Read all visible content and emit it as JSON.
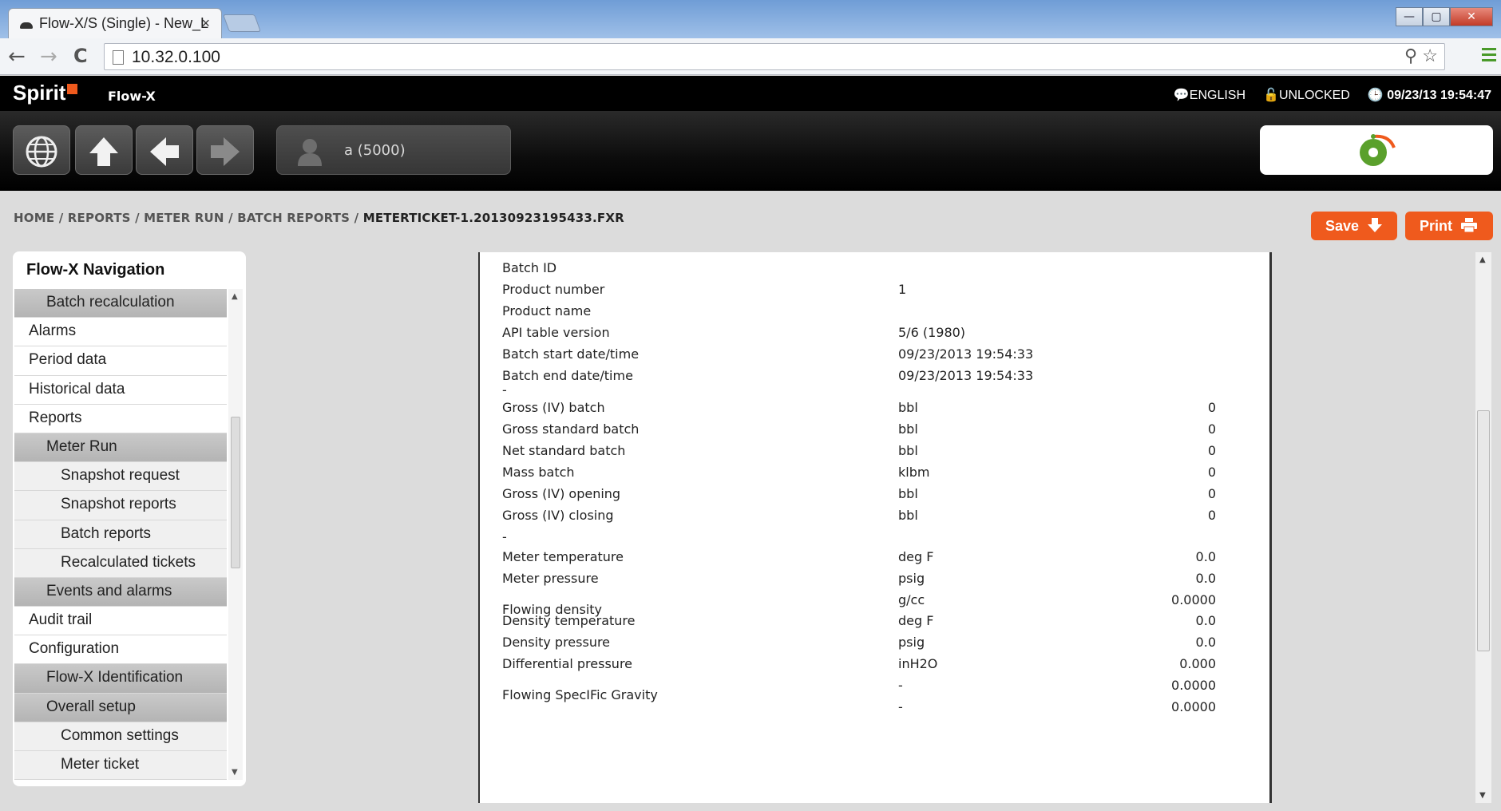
{
  "browser": {
    "tab_title": "Flow-X/S (Single) - New_L",
    "tab_close": "×",
    "url": "10.32.0.100",
    "back": "←",
    "forward": "→",
    "reload": "C",
    "window_controls": [
      "—",
      "▢",
      "✕"
    ],
    "url_tools": "⚲ ☆"
  },
  "app": {
    "logo": "Spirit",
    "product": "Flow-X",
    "language": "ENGLISH",
    "lock_state": "UNLOCKED",
    "datetime": "09/23/13 19:54:47",
    "user": "a (5000)",
    "accent_color": "#ef5a1d"
  },
  "breadcrumb": {
    "path": "HOME / REPORTS / METER RUN / BATCH REPORTS / ",
    "current": "METERTICKET-1.20130923195433.FXR"
  },
  "actions": {
    "save": "Save",
    "print": "Print"
  },
  "nav": {
    "title": "Flow-X Navigation",
    "items": [
      {
        "label": "Batch recalculation",
        "level": 1
      },
      {
        "label": "Alarms",
        "level": 0
      },
      {
        "label": "Period data",
        "level": 0
      },
      {
        "label": "Historical data",
        "level": 0
      },
      {
        "label": "Reports",
        "level": 0
      },
      {
        "label": "Meter Run",
        "level": 1
      },
      {
        "label": "Snapshot request",
        "level": 2
      },
      {
        "label": "Snapshot reports",
        "level": 2
      },
      {
        "label": "Batch reports",
        "level": 2
      },
      {
        "label": "Recalculated tickets",
        "level": 2
      },
      {
        "label": "Events and alarms",
        "level": 1
      },
      {
        "label": "Audit trail",
        "level": 0
      },
      {
        "label": "Configuration",
        "level": 0
      },
      {
        "label": "Flow-X Identification",
        "level": 1
      },
      {
        "label": "Overall setup",
        "level": 1
      },
      {
        "label": "Common settings",
        "level": 2
      },
      {
        "label": "Meter ticket",
        "level": 2
      }
    ]
  },
  "report": {
    "rows": [
      {
        "label": "Batch ID",
        "unit": "",
        "value": ""
      },
      {
        "label": "Product number",
        "unit": "1",
        "value": ""
      },
      {
        "label": "Product name",
        "unit": "",
        "value": ""
      },
      {
        "label": "API table version",
        "unit": "5/6 (1980)",
        "value": ""
      },
      {
        "label": "Batch start date/time",
        "unit": "09/23/2013 19:54:33",
        "value": ""
      },
      {
        "label": "Batch end date/time",
        "unit": "09/23/2013 19:54:33",
        "value": ""
      },
      {
        "label": "-",
        "unit": "",
        "value": ""
      },
      {
        "label": "Gross (IV) batch",
        "unit": "bbl",
        "value": "0"
      },
      {
        "label": "Gross standard batch",
        "unit": "bbl",
        "value": "0"
      },
      {
        "label": "Net standard batch",
        "unit": "bbl",
        "value": "0"
      },
      {
        "label": "Mass batch",
        "unit": "klbm",
        "value": "0"
      },
      {
        "label": "Gross (IV) opening",
        "unit": "bbl",
        "value": "0"
      },
      {
        "label": "Gross (IV) closing",
        "unit": "bbl",
        "value": "0"
      },
      {
        "label": "-",
        "unit": "",
        "value": ""
      },
      {
        "label": "Meter temperature",
        "unit": "deg F",
        "value": "0.0"
      },
      {
        "label": "Meter pressure",
        "unit": "psig",
        "value": "0.0"
      },
      {
        "label": "",
        "unit": "g/cc",
        "value": "0.0000"
      },
      {
        "label": "Flowing density",
        "unit": "",
        "value": ""
      },
      {
        "label": "Density temperature",
        "unit": "deg F",
        "value": "0.0"
      },
      {
        "label": "Density pressure",
        "unit": "psig",
        "value": "0.0"
      },
      {
        "label": "Differential pressure",
        "unit": "inH2O",
        "value": "0.000"
      },
      {
        "label": "",
        "unit": "-",
        "value": "0.0000"
      },
      {
        "label": "Flowing SpecIFic Gravity",
        "unit": "",
        "value": ""
      },
      {
        "label": "",
        "unit": "-",
        "value": "0.0000"
      }
    ]
  }
}
